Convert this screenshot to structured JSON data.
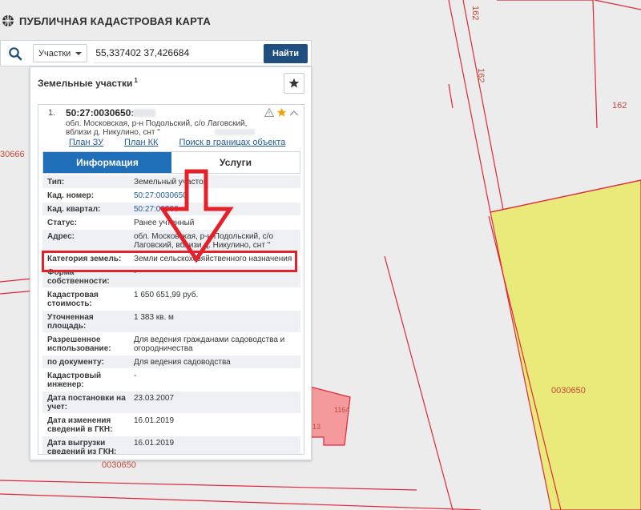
{
  "app": {
    "title": "ПУБЛИЧНАЯ КАДАСТРОВАЯ КАРТА"
  },
  "search": {
    "type": "Участки",
    "query": "55,337402 37,426684",
    "button": "Найти",
    "clear": "×"
  },
  "map": {
    "labels": {
      "left_parcel": "30666",
      "bottom_parcel": "0030650",
      "right_parcel": "0030650",
      "top_road": "162",
      "mid_road": "162",
      "right_small": "162",
      "pink_building": "1164",
      "pink_edge": "13"
    },
    "colors": {
      "background": "#ececec",
      "boundary": "#e2263c",
      "yellow_parcel": "#eaea7a",
      "pink_parcel": "#f59a9c"
    }
  },
  "panel": {
    "title": "Земельные участки",
    "count": "1",
    "result": {
      "index": "1.",
      "cad_number": "50:27:0030650:",
      "address": "обл. Московская, р-н Подольский, с/о Лаговский, вблизи д. Никулино, снт \""
    },
    "links": [
      "План ЗУ →",
      "План КК →",
      "Поиск в границах объекта →"
    ],
    "tabs": {
      "info": "Информация",
      "services": "Услуги"
    },
    "properties": [
      {
        "label": "Тип:",
        "value": "Земельный участок",
        "link": false
      },
      {
        "label": "Кад. номер:",
        "value": "50:27:0030650",
        "link": true
      },
      {
        "label": "Кад. квартал:",
        "value": "50:27:00306",
        "link": true
      },
      {
        "label": "Статус:",
        "value": "Ранее учтенный",
        "link": false
      },
      {
        "label": "Адрес:",
        "value": "обл. Московская, р-н Подольский, с/о Лаговский, вблизи д. Никулино, снт \"",
        "link": false
      },
      {
        "label": "Категория земель:",
        "value": "Земли сельскохозяйственного назначения",
        "link": false
      },
      {
        "label": "Форма собственности:",
        "value": "-",
        "link": false
      },
      {
        "label": "Кадастровая стоимость:",
        "value": "1 650 651,99 руб.",
        "link": false
      },
      {
        "label": "Уточненная площадь:",
        "value": "1 383 кв. м",
        "link": false
      },
      {
        "label": "Разрешенное использование:",
        "value": "Для ведения гражданами садоводства и огородничества",
        "link": false
      },
      {
        "label": "по документу:",
        "value": "Для ведения садоводства",
        "link": false
      },
      {
        "label": "Кадастровый инженер:",
        "value": "-",
        "link": false
      },
      {
        "label": "Дата постановки на учет:",
        "value": "23.03.2007",
        "link": false
      },
      {
        "label": "Дата изменения сведений в ГКН:",
        "value": "16.01.2019",
        "link": false
      },
      {
        "label": "Дата выгрузки сведений из ГКН:",
        "value": "16.01.2019",
        "link": false
      }
    ]
  },
  "annotation": {
    "color": "#e4202a"
  }
}
